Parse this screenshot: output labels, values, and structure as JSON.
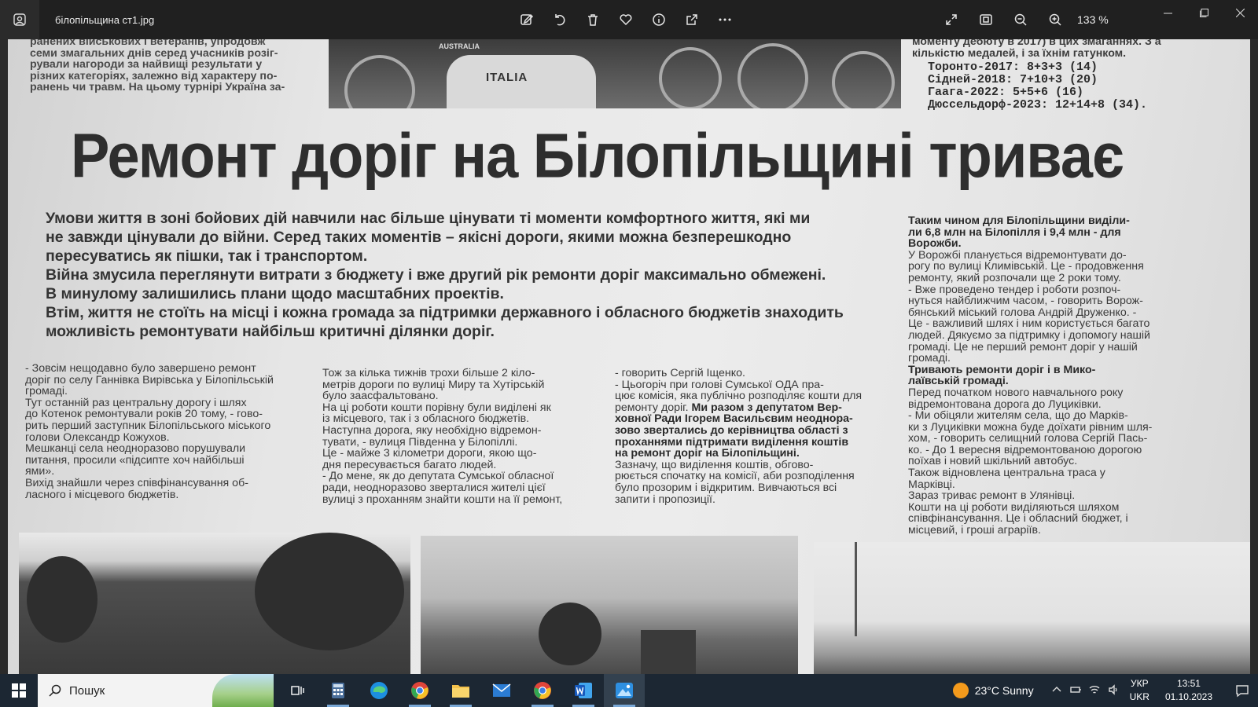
{
  "window": {
    "filename": "білопільщина ст1.jpg",
    "zoom": "133 %"
  },
  "toolbar": {
    "icons": [
      "edit-image-icon",
      "rotate-icon",
      "delete-icon",
      "favorite-icon",
      "info-icon",
      "share-icon",
      "more-icon"
    ],
    "right_icons": [
      "fullscreen-icon",
      "fit-icon",
      "zoom-out-icon",
      "zoom-in-icon"
    ]
  },
  "article": {
    "top_left": "ранених військових і ветеранів, упродовж\nсеми змагальних днів серед учасників розіг-\nрували нагороди за найвищі результати у\nрізних категоріях, залежно від характеру по-\nранень чи травм. На цьому турнірі Україна за-",
    "top_right": "моменту дебюту в 2017) в цих змаганнях. З а\nкількістю медалей, і за їхнім гатунком.",
    "results": [
      "Торонто-2017: 8+3+3 (14)",
      "Сідней-2018: 7+10+3 (20)",
      "Гаага-2022: 5+5+6 (16)",
      "Дюссельдорф-2023: 12+14+8 (34)."
    ],
    "photo_text_1": "AUSTRALIA",
    "photo_text_2": "ITALIA",
    "headline": "Ремонт доріг на Білопільщині триває",
    "lead": "Умови життя в зоні бойових дій навчили нас більше цінувати ті моменти комфортного життя, які ми\nне завжди цінували до війни. Серед таких моментів – якісні дороги, якими можна безперешкодно\nпересуватись як пішки, так і транспортом.\nВійна змусила переглянути витрати з бюджету і вже другий рік ремонти доріг максимально обмежені.\nВ минулому залишились плани щодо масштабних проектів.\nВтім, життя не стоїть на місці і кожна громада за підтримки державного і обласного бюджетів знаходить\nможливість ремонтувати найбільш критичні ділянки доріг.",
    "col1": "   - Зовсім нещодавно було завершено ремонт\nдоріг по селу Ганнівка Вирівська у Білопільській\nгромаді.\n   Тут останній раз центральну дорогу і шлях\nдо Котенок ремонтували років 20 тому, - гово-\nрить перший заступник Білопільського міського\nголови Олександр Кожухов.\n   Мешканці села неодноразово порушували\nпитання, просили «підсипте хоч найбільші\nями».\n   Вихід знайшли через співфінансування об-\nласного і місцевого бюджетів.",
    "col2": "   Тож за кілька тижнів трохи більше 2 кіло-\nметрів дороги по вулиці Миру та Хутірській\nбуло заасфальтовано.\n   На ці роботи кошти порівну були виділені як\nіз місцевого,  так і з обласного бюджетів.\n   Наступна дорога, яку необхідно відремон-\nтувати, - вулиця Південна у Білопіллі.\n   Це - майже 3 кілометри дороги, якою що-\nдня пересувається багато людей.\n   - До мене, як до депутата Сумської обласної\nради, неодноразово зверталися жителі цієї\nвулиці з проханням знайти кошти на її ремонт,",
    "col3_a": "- говорить Сергій Іщенко.\n   - Цьогоріч при голові Сумської ОДА пра-\nцює комісія, яка публічно розподіляє кошти для\nремонту доріг. ",
    "col3_b": "Ми разом з депутатом Вер-\nховної Ради Ігорем Васильєвим неоднора-\nзово звертались до керівництва області з\nпроханнями підтримати виділення коштів\nна ремонт доріг на Білопільщині.",
    "col3_c": "\n   Зазначу, що виділення коштів, обгово-\nрюється спочатку на комісії, аби розподілення\nбуло прозорим і відкритим. Вивчаються всі\nзапити і пропозиції.",
    "col4_a": "   Таким чином для Білопільщини виділи-\nли 6,8 млн  на Білопілля і 9,4 млн - для\nВорожби.",
    "col4_b": "\n   У Ворожбі планується відремонтувати до-\nрогу по вулиці Климівській. Це - продовження\nремонту, який розпочали ще 2 роки тому.\n   - Вже проведено тендер і роботи розпоч-\nнуться найближчим часом, - говорить Ворож-\nбянський міський голова Андрій Друженко. -\nЦе - важливий шлях і ним користується багато\nлюдей. Дякуємо за підтримку і допомогу нашій\nгромаді. Це не перший ремонт доріг у нашій\nгромаді.\n",
    "col4_c": "   Тривають ремонти доріг і в Мико-\nлаївській громаді.",
    "col4_d": "\n   Перед початком нового навчального року\nвідремонтована дорога до Луциківки.\n   - Ми обіцяли жителям села, що до Марків-\nки з Луциківки можна буде доїхати рівним шля-\nхом, - говорить селищний голова Сергій Пась-\nко. - До 1 вересня відремонтованою дорогою\nпоїхав і новий шкільний автобус.\n   Також відновлена центральна траса у\nМарківці.\n   Зараз триває ремонт в Улянівці.\n   Кошти на ці роботи виділяються шляхом\nспівфінансування. Це і обласний бюджет, і\nмісцевий, і гроші аграріїв."
  },
  "taskbar": {
    "search_placeholder": "Пошук",
    "weather": "23°C  Sunny",
    "lang_1": "УКР",
    "lang_2": "UKR",
    "time": "13:51",
    "date": "01.10.2023"
  }
}
